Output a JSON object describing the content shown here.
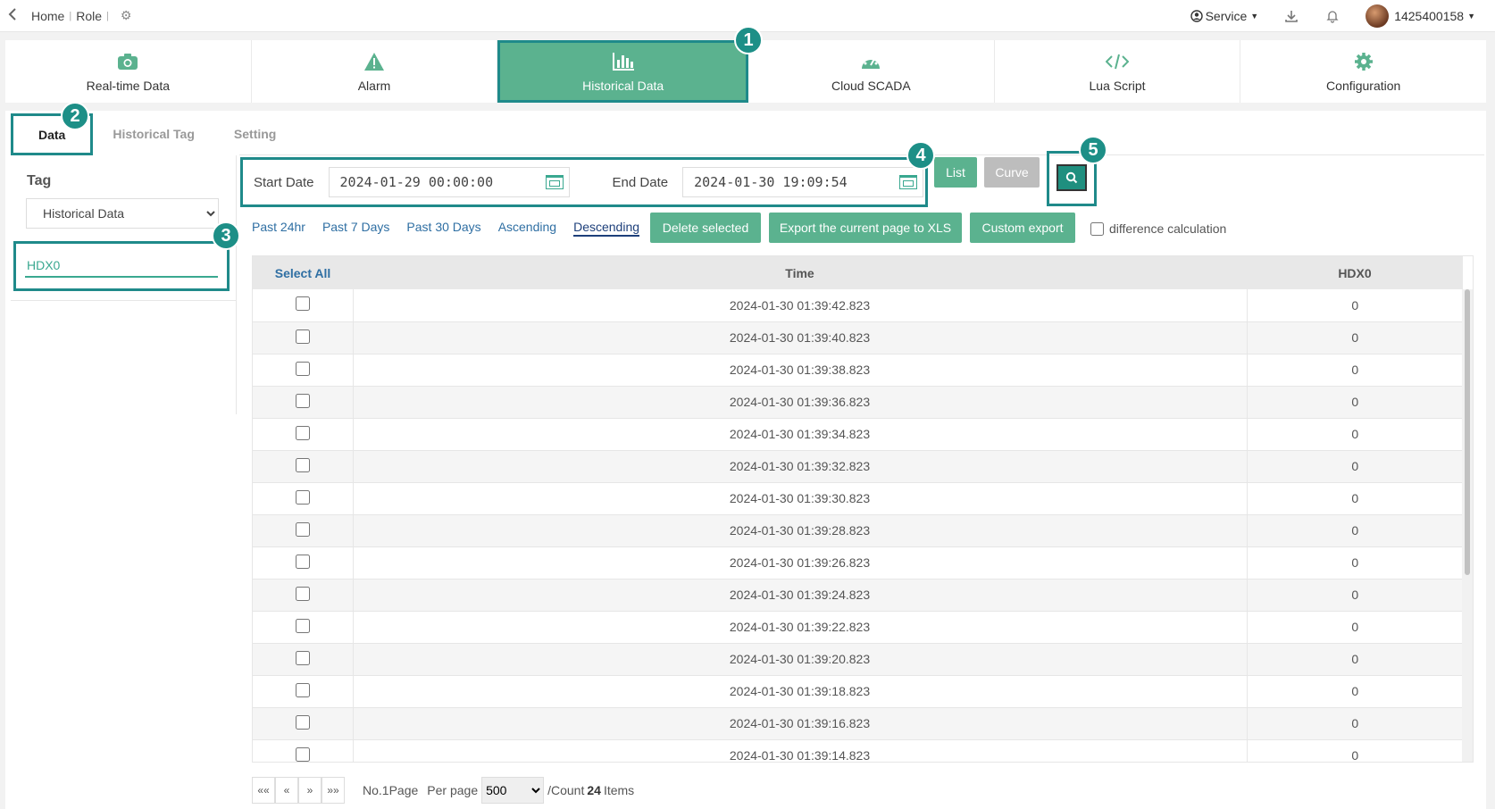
{
  "topbar": {
    "back_icon": "chevron-left-icon",
    "crumbs": [
      "Home",
      "Role"
    ],
    "service_label": "Service",
    "user_id": "1425400158"
  },
  "modules": [
    {
      "label": "Real-time Data",
      "icon": "camera-icon"
    },
    {
      "label": "Alarm",
      "icon": "warning-icon"
    },
    {
      "label": "Historical Data",
      "icon": "bar-chart-icon"
    },
    {
      "label": "Cloud SCADA",
      "icon": "dashboard-icon"
    },
    {
      "label": "Lua Script",
      "icon": "code-icon"
    },
    {
      "label": "Configuration",
      "icon": "gear-icon"
    }
  ],
  "badges": [
    "1",
    "2",
    "3",
    "4",
    "5"
  ],
  "subtabs": [
    "Data",
    "Historical Tag",
    "Setting"
  ],
  "left": {
    "tag_title": "Tag",
    "select_value": "Historical Data",
    "tag_item": "HDX0"
  },
  "daterange": {
    "start_label": "Start Date",
    "start_value": "2024-01-29 00:00:00",
    "end_label": "End Date",
    "end_value": "2024-01-30 19:09:54"
  },
  "buttons": {
    "list": "List",
    "curve": "Curve",
    "delete": "Delete selected",
    "export_page": "Export the current page to XLS",
    "custom_export": "Custom export"
  },
  "quicklinks": [
    "Past 24hr",
    "Past 7 Days",
    "Past 30 Days",
    "Ascending",
    "Descending"
  ],
  "diff_label": "difference calculation",
  "table": {
    "headers": [
      "Select All",
      "Time",
      "HDX0"
    ],
    "rows": [
      [
        "2024-01-30 01:39:42.823",
        "0"
      ],
      [
        "2024-01-30 01:39:40.823",
        "0"
      ],
      [
        "2024-01-30 01:39:38.823",
        "0"
      ],
      [
        "2024-01-30 01:39:36.823",
        "0"
      ],
      [
        "2024-01-30 01:39:34.823",
        "0"
      ],
      [
        "2024-01-30 01:39:32.823",
        "0"
      ],
      [
        "2024-01-30 01:39:30.823",
        "0"
      ],
      [
        "2024-01-30 01:39:28.823",
        "0"
      ],
      [
        "2024-01-30 01:39:26.823",
        "0"
      ],
      [
        "2024-01-30 01:39:24.823",
        "0"
      ],
      [
        "2024-01-30 01:39:22.823",
        "0"
      ],
      [
        "2024-01-30 01:39:20.823",
        "0"
      ],
      [
        "2024-01-30 01:39:18.823",
        "0"
      ],
      [
        "2024-01-30 01:39:16.823",
        "0"
      ],
      [
        "2024-01-30 01:39:14.823",
        "0"
      ]
    ]
  },
  "pager": {
    "first": "««",
    "prev": "«",
    "next": "»",
    "last": "»»",
    "page_text": "No.1Page",
    "per_page_label": "Per page",
    "per_page_value": "500",
    "count_prefix": "/Count",
    "count_value": "24",
    "count_suffix": "Items"
  }
}
